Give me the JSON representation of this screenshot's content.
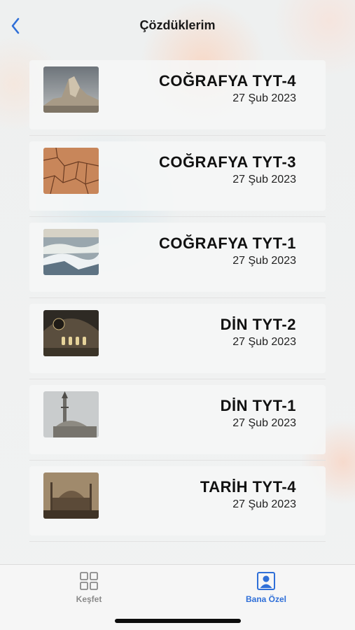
{
  "header": {
    "title": "Çözdüklerim",
    "back_icon": "chevron-left-icon"
  },
  "colors": {
    "accent": "#2f6fd8",
    "inactive_tab": "#8a8a8a"
  },
  "items": [
    {
      "title": "COĞRAFYA TYT-4",
      "date": "27 Şub 2023",
      "image": "rock-mountain-photo"
    },
    {
      "title": "COĞRAFYA TYT-3",
      "date": "27 Şub 2023",
      "image": "cracked-earth-photo"
    },
    {
      "title": "COĞRAFYA TYT-1",
      "date": "27 Şub 2023",
      "image": "fog-landscape-photo"
    },
    {
      "title": "DİN TYT-2",
      "date": "27 Şub 2023",
      "image": "mosque-interior-photo"
    },
    {
      "title": "DİN TYT-1",
      "date": "27 Şub 2023",
      "image": "minaret-photo"
    },
    {
      "title": "TARİH TYT-4",
      "date": "27 Şub 2023",
      "image": "hagia-sophia-photo"
    }
  ],
  "tabbar": {
    "tabs": [
      {
        "label": "Keşfet",
        "icon": "grid-icon",
        "active": false
      },
      {
        "label": "Bana Özel",
        "icon": "profile-icon",
        "active": true
      }
    ]
  }
}
